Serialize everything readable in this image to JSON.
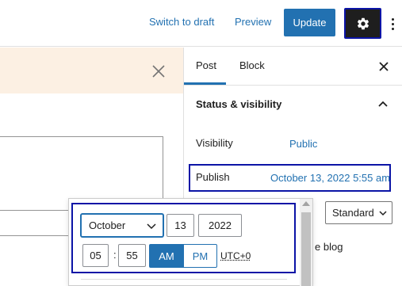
{
  "toolbar": {
    "switch_to_draft": "Switch to draft",
    "preview": "Preview",
    "update": "Update",
    "settings_icon": "gear-icon",
    "more_icon": "vertical-ellipsis-icon"
  },
  "sidebar": {
    "tabs": [
      {
        "label": "Post",
        "active": true
      },
      {
        "label": "Block",
        "active": false
      }
    ],
    "panel_title": "Status & visibility",
    "visibility_label": "Visibility",
    "visibility_value": "Public",
    "publish_label": "Publish",
    "publish_value": "October 13, 2022 5:55 am",
    "format_value": "Standard",
    "blog_text_partial": "e blog"
  },
  "datetime_picker": {
    "month": "October",
    "day": "13",
    "year": "2022",
    "hours": "05",
    "minutes": "55",
    "am_label": "AM",
    "pm_label": "PM",
    "selected_period": "AM",
    "timezone": "UTC+0"
  },
  "colors": {
    "accent": "#2271b1",
    "highlight_border": "#0b14a6",
    "notice_bg": "#fcf0e3",
    "dark": "#1e1e1e"
  }
}
